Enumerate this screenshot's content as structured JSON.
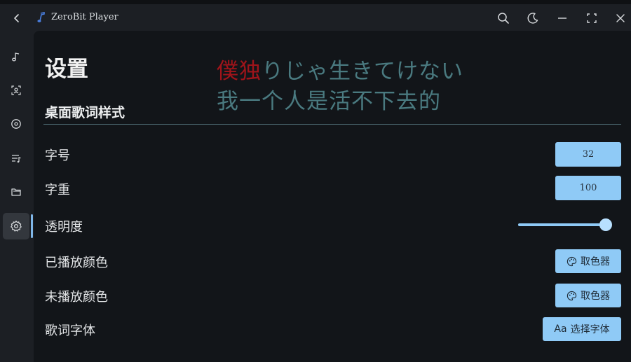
{
  "window": {
    "title": "ZeroBit Player"
  },
  "titlebar": {
    "back_icon": "chevron-left-icon",
    "logo_icon": "music-note-logo-icon",
    "search_icon": "search-icon",
    "theme_icon": "moon-icon",
    "minimize_icon": "minimize-icon",
    "fullscreen_icon": "fullscreen-icon",
    "close_icon": "close-icon"
  },
  "sidebar": {
    "items": [
      {
        "icon": "music-note-icon"
      },
      {
        "icon": "face-scan-icon"
      },
      {
        "icon": "disc-icon"
      },
      {
        "icon": "playlist-icon"
      },
      {
        "icon": "folder-icon"
      },
      {
        "icon": "gear-icon",
        "active": true
      }
    ]
  },
  "page": {
    "title": "设置",
    "section_title": "桌面歌词样式"
  },
  "lyrics_preview": {
    "line1_played": "僕独",
    "line1_unplayed": "りじゃ生きてけない",
    "line2": "我一个人是活不下去的",
    "played_color": "#a0141a",
    "unplayed_color": "#4a7a80"
  },
  "settings": {
    "font_size": {
      "label": "字号",
      "value": "32"
    },
    "font_weight": {
      "label": "字重",
      "value": "100"
    },
    "opacity": {
      "label": "透明度",
      "value": 1.0
    },
    "played_color": {
      "label": "已播放颜色",
      "button": "取色器",
      "icon": "palette-icon"
    },
    "unplayed_color": {
      "label": "未播放颜色",
      "button": "取色器",
      "icon": "palette-icon"
    },
    "lyric_font": {
      "label": "歌词字体",
      "button": "选择字体",
      "icon_text": "Aa"
    }
  },
  "colors": {
    "accent": "#8fcaf6",
    "background": "#121519",
    "sidebar": "#1c1f24"
  }
}
